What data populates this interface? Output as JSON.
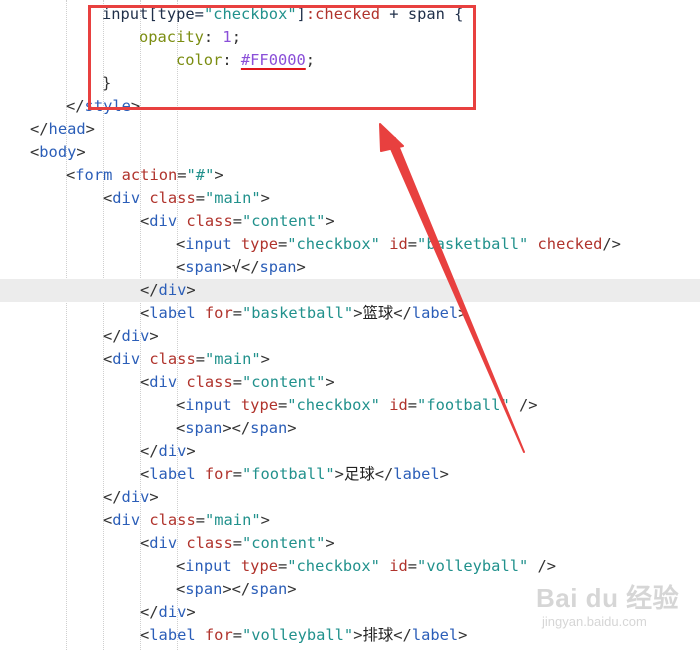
{
  "editor": {
    "lines": [
      [
        {
          "t": "input[type=",
          "c": "csssel"
        },
        {
          "t": "\"checkbox\"",
          "c": "cssstr"
        },
        {
          "t": "]",
          "c": "csssel"
        },
        {
          "t": ":checked",
          "c": "csspseudo"
        },
        {
          "t": " + span {",
          "c": "csssel"
        }
      ],
      [
        {
          "t": "opacity",
          "c": "cssprop"
        },
        {
          "t": ": ",
          "c": "punct"
        },
        {
          "t": "1",
          "c": "cssnum"
        },
        {
          "t": ";",
          "c": "punct"
        }
      ],
      [
        {
          "t": "color",
          "c": "cssprop"
        },
        {
          "t": ": ",
          "c": "punct"
        },
        {
          "t": "#FF0000",
          "c": "csscolor squiggle"
        },
        {
          "t": ";",
          "c": "punct"
        }
      ],
      [
        {
          "t": "}",
          "c": "punct"
        }
      ],
      [
        {
          "t": "</",
          "c": "punct"
        },
        {
          "t": "style",
          "c": "tag"
        },
        {
          "t": ">",
          "c": "punct"
        }
      ],
      [
        {
          "t": "</",
          "c": "punct"
        },
        {
          "t": "head",
          "c": "tag"
        },
        {
          "t": ">",
          "c": "punct"
        }
      ],
      [
        {
          "t": "<",
          "c": "punct"
        },
        {
          "t": "body",
          "c": "tag"
        },
        {
          "t": ">",
          "c": "punct"
        }
      ],
      [
        {
          "t": "<",
          "c": "punct"
        },
        {
          "t": "form",
          "c": "tag"
        },
        {
          "t": " ",
          "c": "punct"
        },
        {
          "t": "action",
          "c": "attr"
        },
        {
          "t": "=",
          "c": "punct"
        },
        {
          "t": "\"#\"",
          "c": "str"
        },
        {
          "t": ">",
          "c": "punct"
        }
      ],
      [
        {
          "t": "<",
          "c": "punct"
        },
        {
          "t": "div",
          "c": "tag"
        },
        {
          "t": " ",
          "c": "punct"
        },
        {
          "t": "class",
          "c": "attr"
        },
        {
          "t": "=",
          "c": "punct"
        },
        {
          "t": "\"main\"",
          "c": "str"
        },
        {
          "t": ">",
          "c": "punct"
        }
      ],
      [
        {
          "t": "<",
          "c": "punct"
        },
        {
          "t": "div",
          "c": "tag"
        },
        {
          "t": " ",
          "c": "punct"
        },
        {
          "t": "class",
          "c": "attr"
        },
        {
          "t": "=",
          "c": "punct"
        },
        {
          "t": "\"content\"",
          "c": "str"
        },
        {
          "t": ">",
          "c": "punct"
        }
      ],
      [
        {
          "t": "<",
          "c": "punct"
        },
        {
          "t": "input",
          "c": "tag"
        },
        {
          "t": " ",
          "c": "punct"
        },
        {
          "t": "type",
          "c": "attr"
        },
        {
          "t": "=",
          "c": "punct"
        },
        {
          "t": "\"checkbox\"",
          "c": "str"
        },
        {
          "t": " ",
          "c": "punct"
        },
        {
          "t": "id",
          "c": "attr"
        },
        {
          "t": "=",
          "c": "punct"
        },
        {
          "t": "\"basketball\"",
          "c": "str"
        },
        {
          "t": " ",
          "c": "punct"
        },
        {
          "t": "checked",
          "c": "attr"
        },
        {
          "t": "/>",
          "c": "punct"
        }
      ],
      [
        {
          "t": "<",
          "c": "punct"
        },
        {
          "t": "span",
          "c": "tag"
        },
        {
          "t": ">",
          "c": "punct"
        },
        {
          "t": "√",
          "c": "text"
        },
        {
          "t": "</",
          "c": "punct"
        },
        {
          "t": "span",
          "c": "tag"
        },
        {
          "t": ">",
          "c": "punct"
        }
      ],
      [
        {
          "t": "</",
          "c": "punct"
        },
        {
          "t": "div",
          "c": "tag"
        },
        {
          "t": ">",
          "c": "punct"
        }
      ],
      [
        {
          "t": "<",
          "c": "punct"
        },
        {
          "t": "label",
          "c": "tag"
        },
        {
          "t": " ",
          "c": "punct"
        },
        {
          "t": "for",
          "c": "attr"
        },
        {
          "t": "=",
          "c": "punct"
        },
        {
          "t": "\"basketball\"",
          "c": "str"
        },
        {
          "t": ">",
          "c": "punct"
        },
        {
          "t": "篮球",
          "c": "text"
        },
        {
          "t": "</",
          "c": "punct"
        },
        {
          "t": "label",
          "c": "tag"
        },
        {
          "t": ">",
          "c": "punct"
        }
      ],
      [
        {
          "t": "</",
          "c": "punct"
        },
        {
          "t": "div",
          "c": "tag"
        },
        {
          "t": ">",
          "c": "punct"
        }
      ],
      [
        {
          "t": "<",
          "c": "punct"
        },
        {
          "t": "div",
          "c": "tag"
        },
        {
          "t": " ",
          "c": "punct"
        },
        {
          "t": "class",
          "c": "attr"
        },
        {
          "t": "=",
          "c": "punct"
        },
        {
          "t": "\"main\"",
          "c": "str"
        },
        {
          "t": ">",
          "c": "punct"
        }
      ],
      [
        {
          "t": "<",
          "c": "punct"
        },
        {
          "t": "div",
          "c": "tag"
        },
        {
          "t": " ",
          "c": "punct"
        },
        {
          "t": "class",
          "c": "attr"
        },
        {
          "t": "=",
          "c": "punct"
        },
        {
          "t": "\"content\"",
          "c": "str"
        },
        {
          "t": ">",
          "c": "punct"
        }
      ],
      [
        {
          "t": "<",
          "c": "punct"
        },
        {
          "t": "input",
          "c": "tag"
        },
        {
          "t": " ",
          "c": "punct"
        },
        {
          "t": "type",
          "c": "attr"
        },
        {
          "t": "=",
          "c": "punct"
        },
        {
          "t": "\"checkbox\"",
          "c": "str"
        },
        {
          "t": " ",
          "c": "punct"
        },
        {
          "t": "id",
          "c": "attr"
        },
        {
          "t": "=",
          "c": "punct"
        },
        {
          "t": "\"football\"",
          "c": "str"
        },
        {
          "t": " />",
          "c": "punct"
        }
      ],
      [
        {
          "t": "<",
          "c": "punct"
        },
        {
          "t": "span",
          "c": "tag"
        },
        {
          "t": "></",
          "c": "punct"
        },
        {
          "t": "span",
          "c": "tag"
        },
        {
          "t": ">",
          "c": "punct"
        }
      ],
      [
        {
          "t": "</",
          "c": "punct"
        },
        {
          "t": "div",
          "c": "tag"
        },
        {
          "t": ">",
          "c": "punct"
        }
      ],
      [
        {
          "t": "<",
          "c": "punct"
        },
        {
          "t": "label",
          "c": "tag"
        },
        {
          "t": " ",
          "c": "punct"
        },
        {
          "t": "for",
          "c": "attr"
        },
        {
          "t": "=",
          "c": "punct"
        },
        {
          "t": "\"football\"",
          "c": "str"
        },
        {
          "t": ">",
          "c": "punct"
        },
        {
          "t": "足球",
          "c": "text"
        },
        {
          "t": "</",
          "c": "punct"
        },
        {
          "t": "label",
          "c": "tag"
        },
        {
          "t": ">",
          "c": "punct"
        }
      ],
      [
        {
          "t": "</",
          "c": "punct"
        },
        {
          "t": "div",
          "c": "tag"
        },
        {
          "t": ">",
          "c": "punct"
        }
      ],
      [
        {
          "t": "<",
          "c": "punct"
        },
        {
          "t": "div",
          "c": "tag"
        },
        {
          "t": " ",
          "c": "punct"
        },
        {
          "t": "class",
          "c": "attr"
        },
        {
          "t": "=",
          "c": "punct"
        },
        {
          "t": "\"main\"",
          "c": "str"
        },
        {
          "t": ">",
          "c": "punct"
        }
      ],
      [
        {
          "t": "<",
          "c": "punct"
        },
        {
          "t": "div",
          "c": "tag"
        },
        {
          "t": " ",
          "c": "punct"
        },
        {
          "t": "class",
          "c": "attr"
        },
        {
          "t": "=",
          "c": "punct"
        },
        {
          "t": "\"content\"",
          "c": "str"
        },
        {
          "t": ">",
          "c": "punct"
        }
      ],
      [
        {
          "t": "<",
          "c": "punct"
        },
        {
          "t": "input",
          "c": "tag"
        },
        {
          "t": " ",
          "c": "punct"
        },
        {
          "t": "type",
          "c": "attr"
        },
        {
          "t": "=",
          "c": "punct"
        },
        {
          "t": "\"checkbox\"",
          "c": "str"
        },
        {
          "t": " ",
          "c": "punct"
        },
        {
          "t": "id",
          "c": "attr"
        },
        {
          "t": "=",
          "c": "punct"
        },
        {
          "t": "\"volleyball\"",
          "c": "str"
        },
        {
          "t": " />",
          "c": "punct"
        }
      ],
      [
        {
          "t": "<",
          "c": "punct"
        },
        {
          "t": "span",
          "c": "tag"
        },
        {
          "t": "></",
          "c": "punct"
        },
        {
          "t": "span",
          "c": "tag"
        },
        {
          "t": ">",
          "c": "punct"
        }
      ],
      [
        {
          "t": "</",
          "c": "punct"
        },
        {
          "t": "div",
          "c": "tag"
        },
        {
          "t": ">",
          "c": "punct"
        }
      ],
      [
        {
          "t": "<",
          "c": "punct"
        },
        {
          "t": "label",
          "c": "tag"
        },
        {
          "t": " ",
          "c": "punct"
        },
        {
          "t": "for",
          "c": "attr"
        },
        {
          "t": "=",
          "c": "punct"
        },
        {
          "t": "\"volleyball\"",
          "c": "str"
        },
        {
          "t": ">",
          "c": "punct"
        },
        {
          "t": "排球",
          "c": "text"
        },
        {
          "t": "</",
          "c": "punct"
        },
        {
          "t": "label",
          "c": "tag"
        },
        {
          "t": ">",
          "c": "punct"
        }
      ]
    ],
    "highlighted_line": 12,
    "colors": {
      "tag": "#2b5eb8",
      "attribute": "#b0332c",
      "string": "#21918c",
      "css_property": "#7b8d12",
      "css_value": "#8a4fd8",
      "annotation": "#e8403f"
    }
  },
  "annotation": {
    "box_color": "#e8403f",
    "arrow_color": "#e8403f"
  },
  "watermark": {
    "logo_text": "Bai du 经验",
    "url_text": "jingyan.baidu.com"
  }
}
